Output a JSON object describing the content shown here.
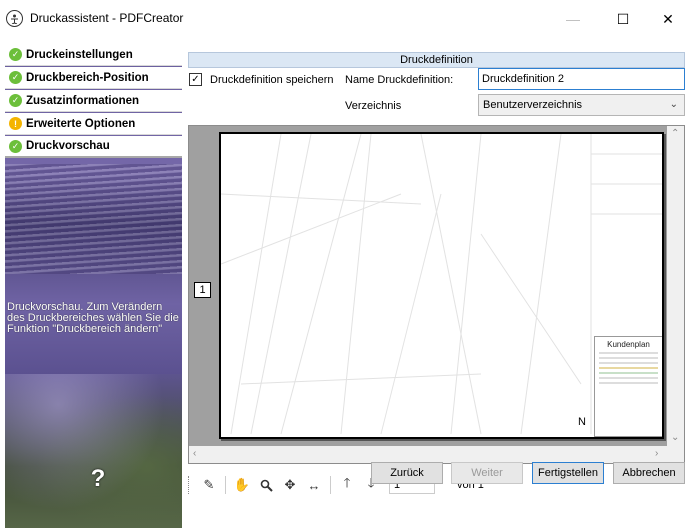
{
  "window": {
    "title": "Druckassistent - PDFCreator",
    "minimize_glyph": "—",
    "maximize_glyph": "☐",
    "close_glyph": "✕"
  },
  "sidebar": {
    "items": [
      {
        "label": "Druckeinstellungen",
        "status": "ok"
      },
      {
        "label": "Druckbereich-Position",
        "status": "ok"
      },
      {
        "label": "Zusatzinformationen",
        "status": "ok"
      },
      {
        "label": "Erweiterte Optionen",
        "status": "warning"
      },
      {
        "label": "Druckvorschau",
        "status": "ok"
      }
    ],
    "help_text": "Druckvorschau. Zum Verändern des Druckbereiches wählen Sie die Funktion \"Druckbereich ändern\"",
    "help_button": "?"
  },
  "form": {
    "section_title": "Druckdefinition",
    "save_checkbox_label": "Druckdefinition speichern",
    "save_checked": true,
    "name_label": "Name Druckdefinition:",
    "name_value": "Druckdefinition 2",
    "dir_label": "Verzeichnis",
    "dir_value": "Benutzerverzeichnis"
  },
  "preview": {
    "page_marker": "1",
    "titleblock_title": "Kundenplan",
    "north_arrow": "N"
  },
  "toolbar": {
    "icons": [
      "pencil-icon",
      "hand-icon",
      "zoom-icon",
      "move-icon",
      "fit-width-icon",
      "arrow-up-icon",
      "arrow-down-icon"
    ],
    "page_value": "1",
    "of_label": "von 1"
  },
  "buttons": {
    "back": "Zurück",
    "next": "Weiter",
    "finish": "Fertigstellen",
    "cancel": "Abbrechen"
  },
  "colors": {
    "accent": "#2c7fd1",
    "ok": "#6cbf3a",
    "warning": "#f4b400",
    "section_header": "#dbe7f4"
  }
}
